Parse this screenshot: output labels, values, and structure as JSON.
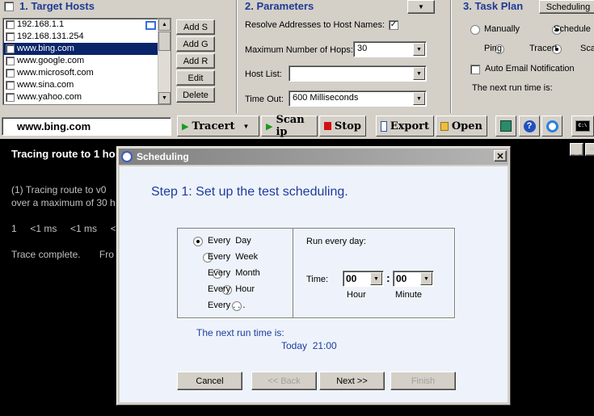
{
  "target_hosts": {
    "title": "1. Target Hosts",
    "hosts": [
      "192.168.1.1",
      "192.168.131.254",
      "www.bing.com",
      "www.google.com",
      "www.microsoft.com",
      "www.sina.com",
      "www.yahoo.com"
    ],
    "selected_index": 2,
    "buttons": {
      "add_s": "Add S",
      "add_g": "Add G",
      "add_r": "Add R",
      "edit": "Edit",
      "delete": "Delete"
    }
  },
  "parameters": {
    "title": "2. Parameters",
    "resolve_label": "Resolve Addresses to Host Names:",
    "max_hops_label": "Maximum Number of Hops:",
    "max_hops_value": "30",
    "host_list_label": "Host List:",
    "host_list_value": "",
    "timeout_label": "Time Out:",
    "timeout_value": "600  Milliseconds"
  },
  "task_plan": {
    "title": "3. Task Plan",
    "scheduling_button": "Scheduling",
    "manually": "Manually",
    "schedule": "Schedule",
    "ping": "Ping",
    "tracert": "Tracert",
    "scan": "Sca",
    "auto_email": "Auto Email Notification",
    "next_run_label": "The next run time is:"
  },
  "toolbar": {
    "address": "www.bing.com",
    "tracert": "Tracert",
    "scan_ip": "Scan ip",
    "stop": "Stop",
    "export": "Export",
    "open": "Open"
  },
  "console": {
    "header": "Tracing route to 1 ho",
    "line1": "(1) Tracing route to v0",
    "line2": "over a maximum of 30 h",
    "hop_row": "1     <1 ms     <1 ms     <",
    "complete": "Trace complete.       Fro"
  },
  "dialog": {
    "title": "Scheduling",
    "step": "Step 1:  Set up the test scheduling.",
    "options": [
      "Every  Day",
      "Every  Week",
      "Every  Month",
      "Every  Hour",
      "Every . . ."
    ],
    "selected_option": 0,
    "run_every": "Run every day:",
    "time_label": "Time:",
    "hour_value": "00",
    "minute_value": "00",
    "hour_label": "Hour",
    "minute_label": "Minute",
    "next_run_label": "The next run time is:",
    "next_run_value": "Today  21:00",
    "cancel": "Cancel",
    "back": "<< Back",
    "next": "Next >>",
    "finish": "Finish"
  }
}
